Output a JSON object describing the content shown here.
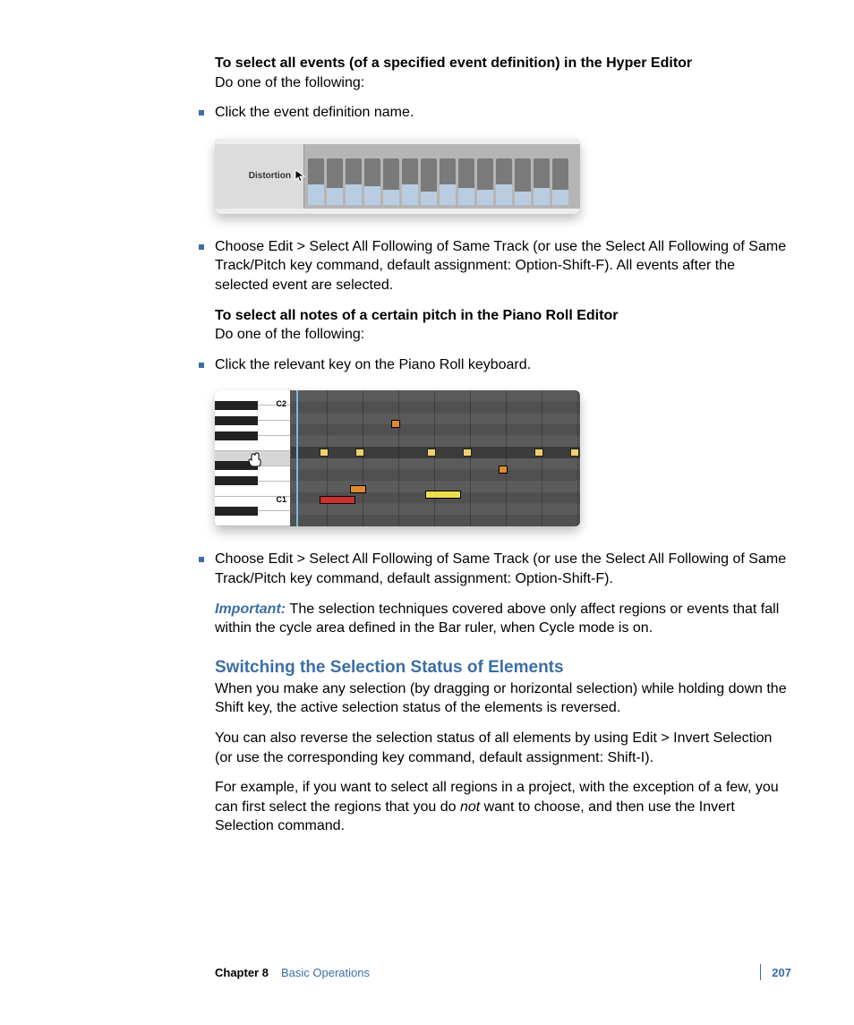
{
  "section1_heading": "To select all events (of a specified event definition) in the Hyper Editor",
  "do_one": "Do one of the following:",
  "bullet1": "Click the event definition name.",
  "hyper_label": "Distortion",
  "bullet2": "Choose Edit > Select All Following of Same Track (or use the Select All Following of Same Track/Pitch key command, default assignment:  Option-Shift-F). All events after the selected event are selected.",
  "section2_heading": "To select all notes of a certain pitch in the Piano Roll Editor",
  "bullet3": "Click the relevant key on the Piano Roll keyboard.",
  "piano_c2": "C2",
  "piano_c1": "C1",
  "bullet4": "Choose Edit > Select All Following of Same Track (or use the Select All Following of Same Track/Pitch key command, default assignment:  Option-Shift-F).",
  "important_label": "Important:  ",
  "important_text": "The selection techniques covered above only affect regions or events that fall within the cycle area defined in the Bar ruler, when Cycle mode is on.",
  "h2": "Switching the Selection Status of Elements",
  "p1": "When you make any selection (by dragging or horizontal selection) while holding down the Shift key, the active selection status of the elements is reversed.",
  "p2": "You can also reverse the selection status of all elements by using Edit > Invert Selection (or use the corresponding key command, default assignment:  Shift-I).",
  "p3a": "For example, if you want to select all regions in a project, with the exception of a few, you can first select the regions that you do ",
  "p3_not": "not",
  "p3b": " want to choose, and then use the Invert Selection command.",
  "footer_chapter": "Chapter 8",
  "footer_title": "Basic Operations",
  "footer_page": "207"
}
